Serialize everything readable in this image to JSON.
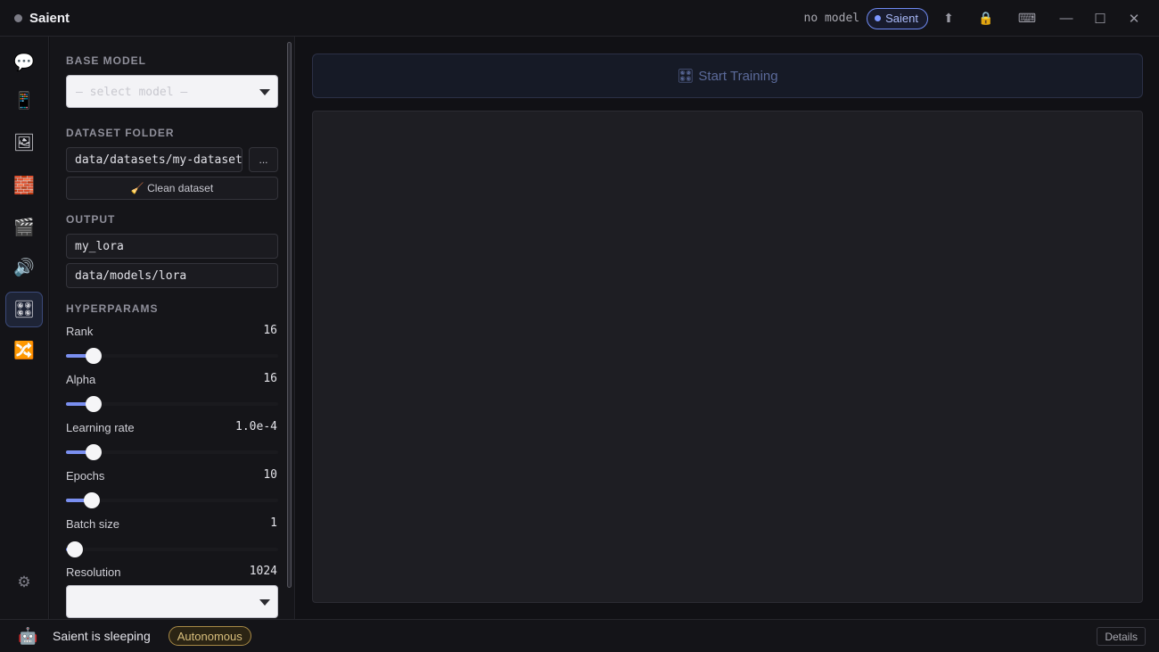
{
  "app": {
    "title": "Saient"
  },
  "titlebar": {
    "model_status": "no model",
    "agent_pill": "Saient",
    "icons": [
      "upload-icon",
      "lock-icon",
      "keyboard-icon"
    ],
    "window_controls": [
      "minimize",
      "maximize",
      "close"
    ]
  },
  "rail": {
    "items": [
      {
        "name": "chat",
        "glyph": "💬"
      },
      {
        "name": "models",
        "glyph": "📱"
      },
      {
        "name": "images",
        "glyph": "🖼"
      },
      {
        "name": "bricks",
        "glyph": "🧱"
      },
      {
        "name": "video",
        "glyph": "🎬"
      },
      {
        "name": "audio",
        "glyph": "🔊"
      },
      {
        "name": "training",
        "glyph": "🎛",
        "active": true
      },
      {
        "name": "merge",
        "glyph": "🔀"
      }
    ],
    "settings_glyph": "⚙"
  },
  "panel": {
    "base_model": {
      "label": "BASE MODEL",
      "placeholder": "— select model —"
    },
    "dataset": {
      "label": "DATASET FOLDER",
      "path": "data/datasets/my-dataset",
      "browse": "...",
      "clean": "🧹 Clean dataset"
    },
    "output": {
      "label": "OUTPUT",
      "name": "my_lora",
      "dir": "data/models/lora"
    },
    "hyperparams": {
      "label": "HYPERPARAMS",
      "rank": {
        "label": "Rank",
        "value": "16",
        "level": 0.13
      },
      "alpha": {
        "label": "Alpha",
        "value": "16",
        "level": 0.13
      },
      "lr": {
        "label": "Learning rate",
        "value": "1.0e-4",
        "level": 0.13
      },
      "epochs": {
        "label": "Epochs",
        "value": "10",
        "level": 0.12
      },
      "batch": {
        "label": "Batch size",
        "value": "1",
        "level": 0.04
      },
      "resolution": {
        "label": "Resolution",
        "value": "1024"
      }
    }
  },
  "main": {
    "start_label": "Start Training",
    "start_glyph": "🎛"
  },
  "status": {
    "text": "Saient is sleeping",
    "badge": "Autonomous",
    "details": "Details"
  },
  "colors": {
    "accent": "#7a8ff0",
    "badge": "#a88a46"
  }
}
